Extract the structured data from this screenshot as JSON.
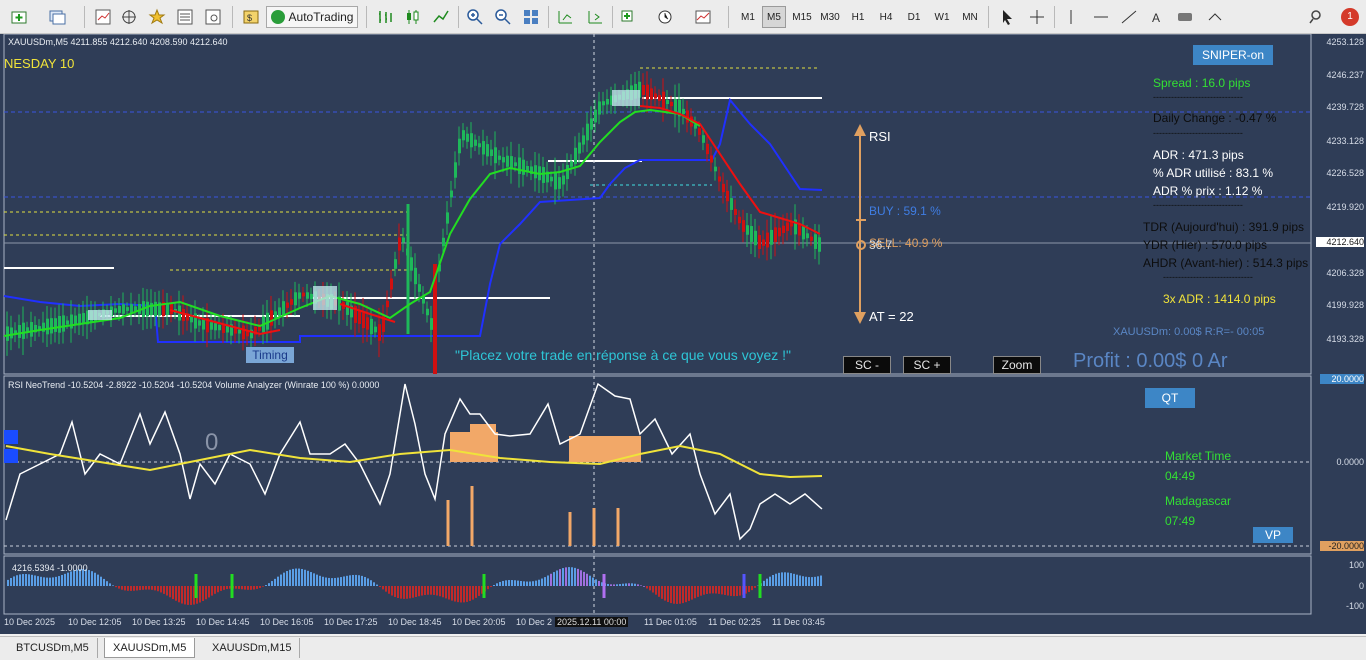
{
  "toolbar": {
    "autotrading_label": "AutoTrading",
    "timeframes": [
      "M1",
      "M5",
      "M15",
      "M30",
      "H1",
      "H4",
      "D1",
      "W1",
      "MN"
    ],
    "active_timeframe": "M5",
    "notification_count": "1"
  },
  "chart": {
    "symbol_header": "XAUUSDm,M5  4211.855 4212.640 4208.590 4212.640",
    "day_label": "NESDAY 10",
    "sniper_button": "SNIPER-on",
    "info": {
      "spread": "Spread : 16.0 pips",
      "divider": "------------------------------",
      "daily_change": "Daily Change : -0.47 %",
      "adr": "ADR : 471.3 pips",
      "adr_used": "% ADR utilisé : 83.1 %",
      "adr_price": "ADR % prix : 1.12 %",
      "tdr": "TDR (Aujourd'hui) : 391.9 pips",
      "ydr": "YDR (Hier) : 570.0 pips",
      "ahdr": "AHDR (Avant-hier) : 514.3 pips",
      "adr3x": "3x ADR : 1414.0 pips",
      "account_line": "XAUUSDm: 0.00$  R:R=-  00:05",
      "profit": "Profit : 0.00$  0 Ar"
    },
    "rsi_label": "RSI",
    "buy_label": "BUY : 59.1 %",
    "sell_label": "SELL: 40.9 %",
    "rsi_value": "36.7",
    "at_label": "AT = 22",
    "timing_button": "Timing",
    "motto": "\"Placez votre trade en réponse à ce que vous voyez !\"",
    "sc_minus": "SC -",
    "sc_plus": "SC +",
    "zoom_button": "Zoom",
    "price_axis": [
      "4253.128",
      "4246.237",
      "4239.728",
      "4233.128",
      "4226.528",
      "4219.920",
      "4212.640",
      "4206.328",
      "4199.928",
      "4193.328"
    ],
    "current_price": "4212.640"
  },
  "indicator1": {
    "header": "RSI NeoTrend -10.5204 -2.8922 -10.5204 -10.5204  Volume Analyzer (Winrate 100 %) 0.0000",
    "zero_label": "0",
    "qt_button": "QT",
    "vp_button": "VP",
    "market_time_label": "Market Time",
    "market_time": "04:49",
    "madagascar_label": "Madagascar",
    "madagascar_time": "07:49",
    "axis_top": "20.0000",
    "axis_mid": "0.0000",
    "axis_bottom": "-20.0000"
  },
  "indicator2": {
    "header": "4216.5394 -1.0000",
    "axis": [
      "100",
      "0",
      "-100"
    ]
  },
  "time_axis": [
    "10 Dec 2025",
    "10 Dec 12:05",
    "10 Dec 13:25",
    "10 Dec 14:45",
    "10 Dec 16:05",
    "10 Dec 17:25",
    "10 Dec 18:45",
    "10 Dec 20:05",
    "10 Dec 2",
    "2025.12.11 00:00",
    "11 Dec 01:05",
    "11 Dec 02:25",
    "11 Dec 03:45"
  ],
  "tabs": [
    "BTCUSDm,M5",
    "XAUUSDm,M5",
    "XAUUSDm,M15"
  ],
  "active_tab": "XAUUSDm,M5"
}
